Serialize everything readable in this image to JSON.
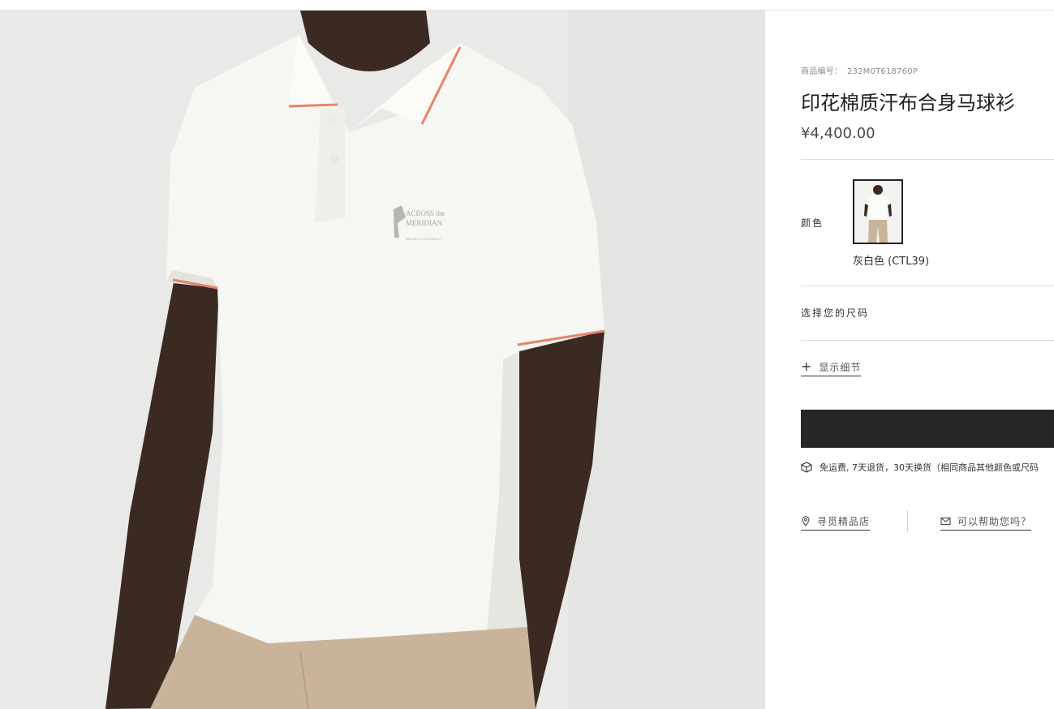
{
  "product": {
    "sku_label": "商品编号：",
    "sku_value": "232M0T618760P",
    "title": "印花棉质汗布合身马球衫",
    "price": "¥4,400.00",
    "image_print_text": {
      "line1": "ACROSS the",
      "line2": "MERIDIAN",
      "line3": "BRUNELLO CUCINELLI"
    }
  },
  "color": {
    "label": "颜色",
    "selected_name": "灰白色 (CTL39)"
  },
  "size": {
    "label": "选择您的尺码"
  },
  "details": {
    "label": "显示细节",
    "icon": "plus-icon"
  },
  "cart": {
    "button_label": ""
  },
  "shipping": {
    "icon": "box-icon",
    "text": "免运费, 7天退货，30天换货（相同商品其他颜色或尺码"
  },
  "links": {
    "store_label": "寻觅精品店",
    "store_icon": "location-pin-icon",
    "help_label": "可以帮助您吗？",
    "help_icon": "envelope-icon"
  },
  "colors": {
    "cart_button": "#262626",
    "shirt": "#f6f6f3",
    "trim": "#e8826a",
    "pants": "#c9b49b",
    "skin": "#3b2a22",
    "background": "#e9e9e8"
  }
}
